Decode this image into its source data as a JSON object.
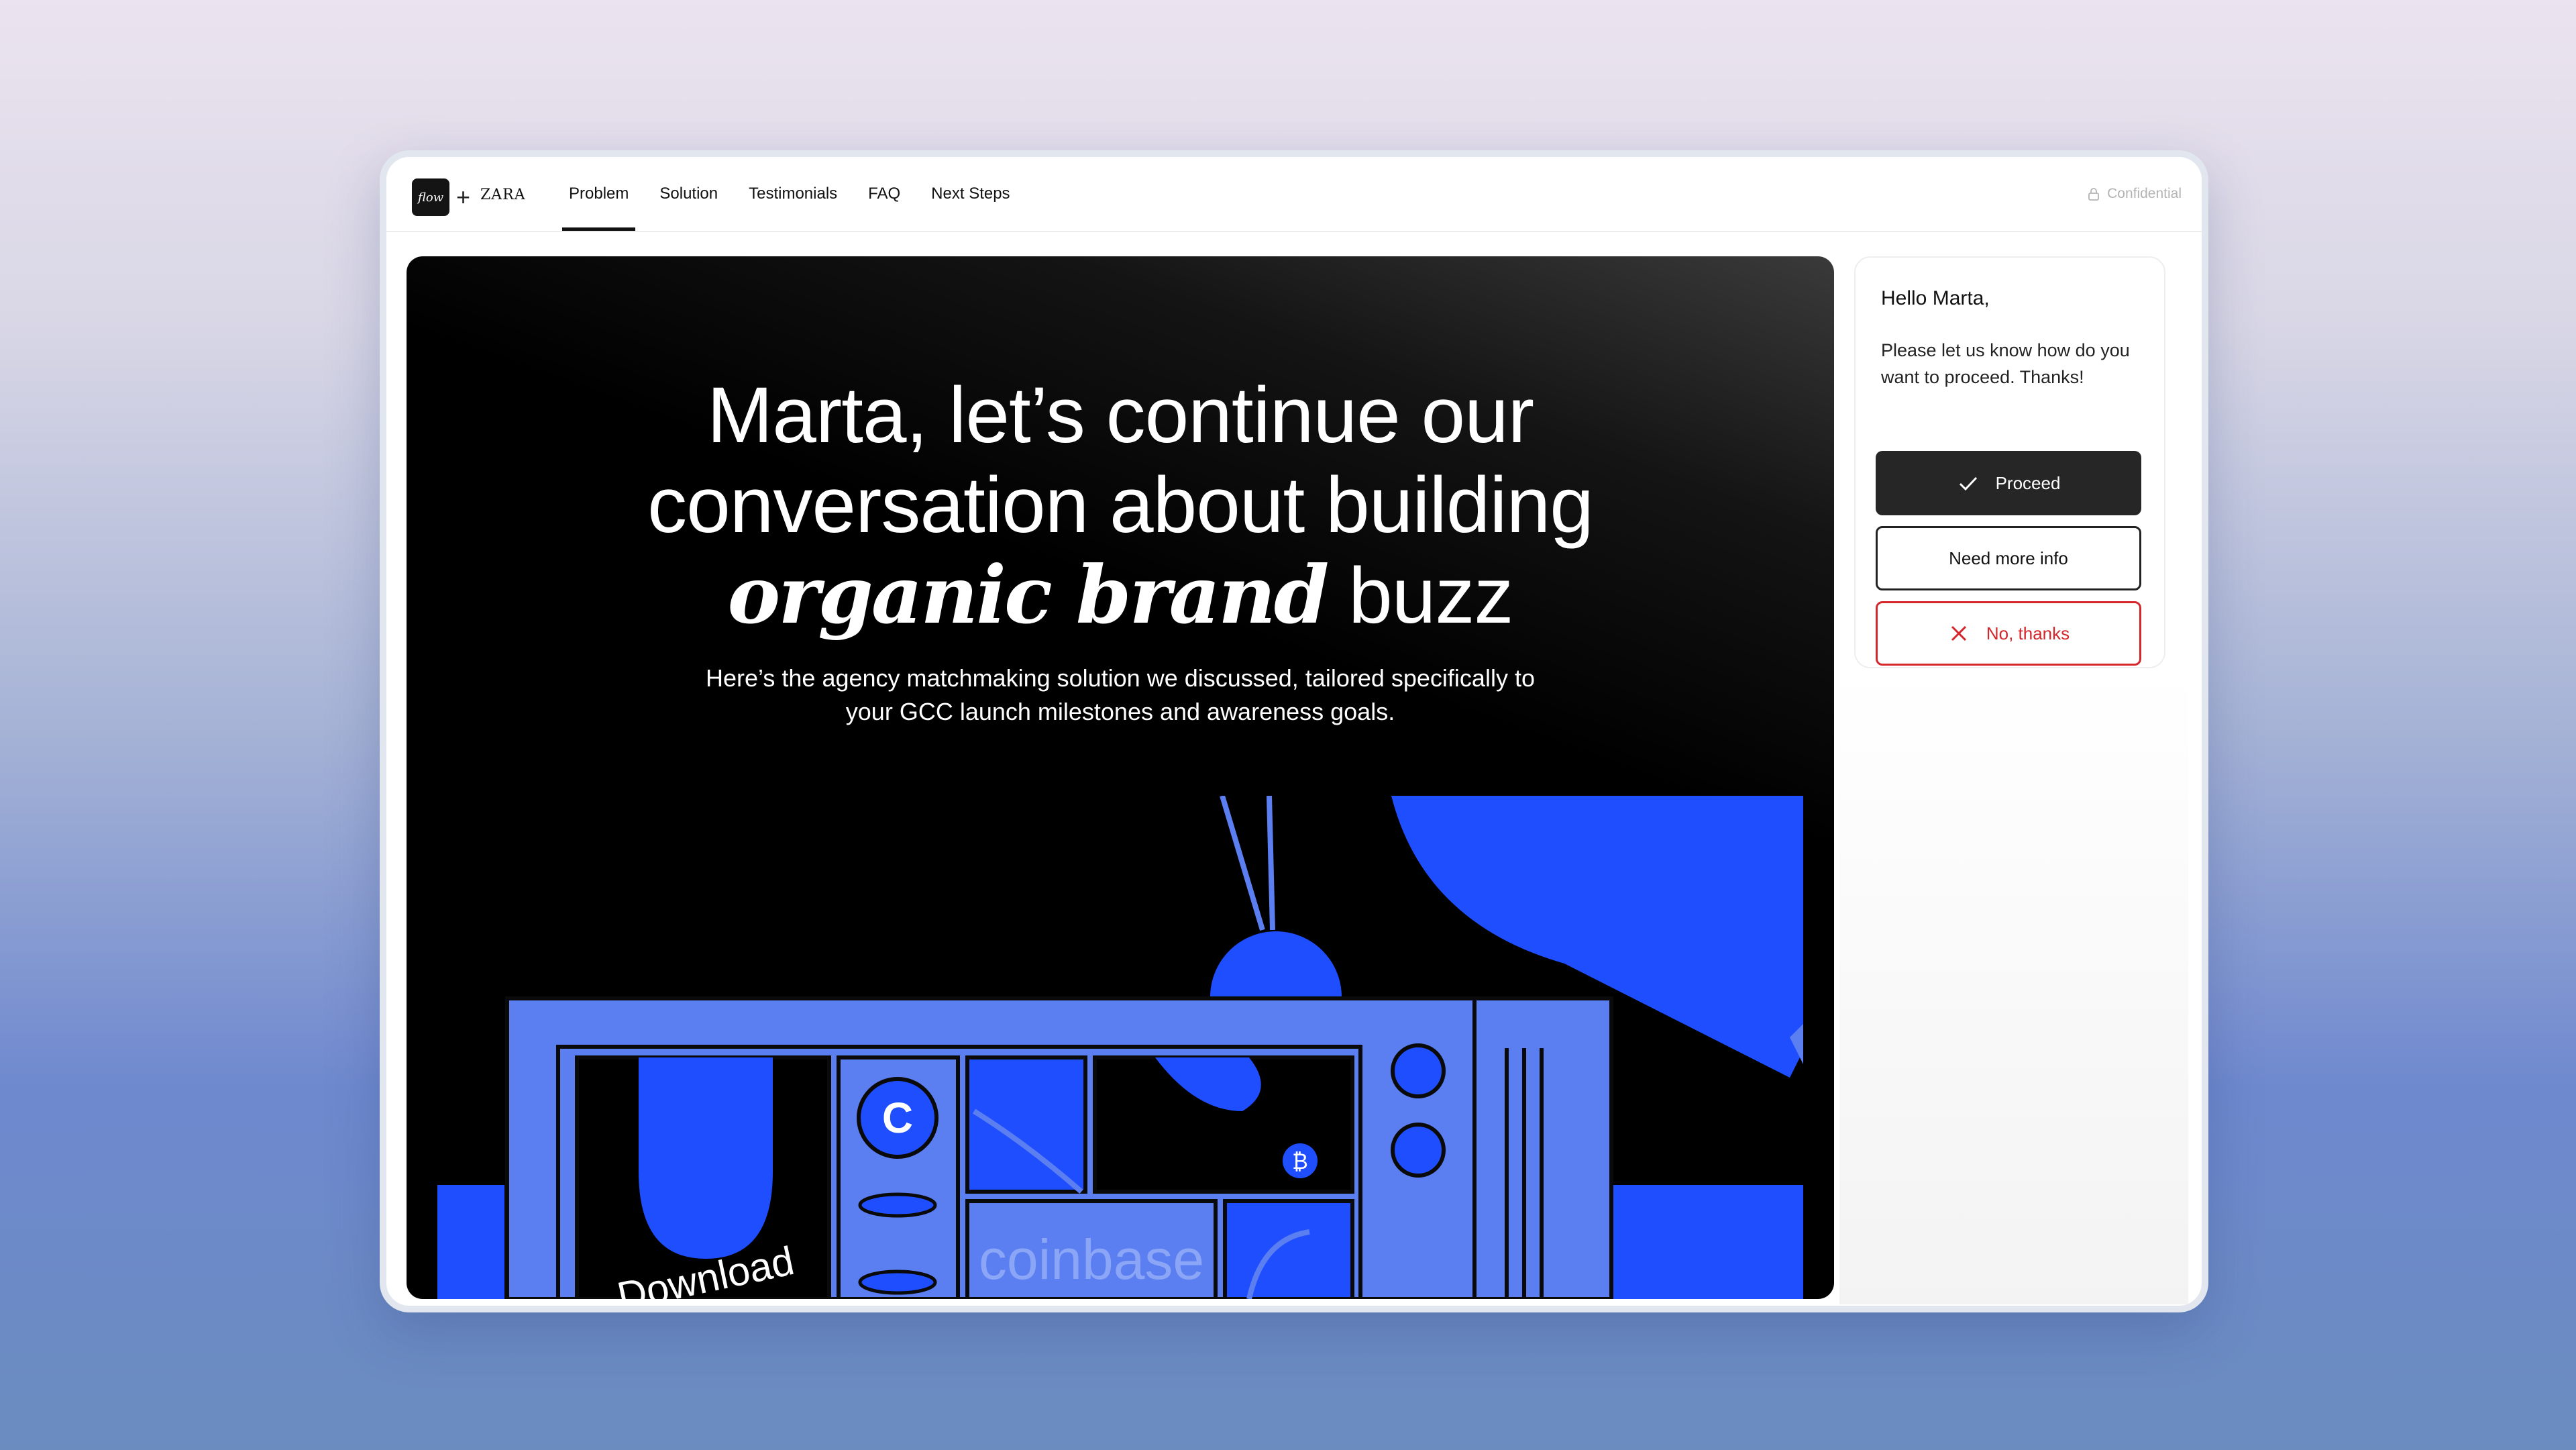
{
  "header": {
    "logo_mark": "flow",
    "plus": "+",
    "partner_logo": "ZARA",
    "tabs": [
      {
        "label": "Problem",
        "active": true
      },
      {
        "label": "Solution",
        "active": false
      },
      {
        "label": "Testimonials",
        "active": false
      },
      {
        "label": "FAQ",
        "active": false
      },
      {
        "label": "Next Steps",
        "active": false
      }
    ],
    "confidential_label": "Confidential",
    "confidential_icon": "lock-icon"
  },
  "hero": {
    "headline_line1": "Marta, let’s continue our",
    "headline_line2": "conversation about building",
    "headline_emphasis": "organic brand",
    "headline_end": "buzz",
    "subtitle_line1": "Here’s the agency matchmaking solution we discussed, tailored specifically to",
    "subtitle_line2": "your GCC launch milestones and awareness goals.",
    "illustration": {
      "screen_word": "Download",
      "brand_word": "coinbase",
      "coin_letter": "C",
      "bitcoin_symbol": "₿"
    }
  },
  "panel": {
    "greeting": "Hello Marta,",
    "message": "Please let us know how do you want to proceed. Thanks!",
    "proceed_label": "Proceed",
    "need_info_label": "Need more info",
    "decline_label": "No, thanks"
  },
  "colors": {
    "accent_blue": "#1f4eff",
    "panel_blue": "#5b7ef0",
    "dark_button": "#262626",
    "danger": "#d4262b"
  }
}
